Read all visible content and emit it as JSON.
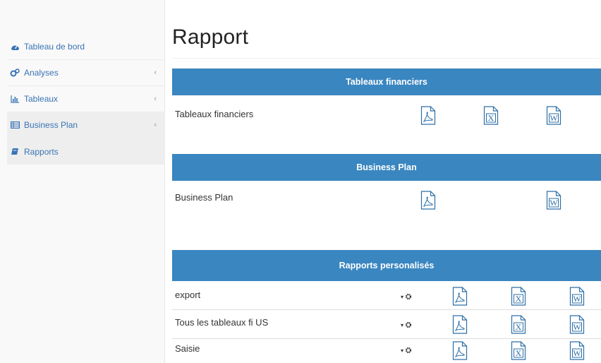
{
  "sidebar": {
    "items": [
      {
        "label": "Tableau de bord",
        "icon": "dashboard-icon"
      },
      {
        "label": "Analyses",
        "icon": "cogs-icon",
        "chevron": "‹"
      },
      {
        "label": "Tableaux",
        "icon": "bar-chart-icon",
        "chevron": "‹"
      },
      {
        "label": "Business Plan",
        "icon": "table-icon",
        "chevron": "‹"
      },
      {
        "label": "Rapports",
        "icon": "book-icon"
      }
    ]
  },
  "page": {
    "title": "Rapport"
  },
  "sections": [
    {
      "header": "Tableaux financiers",
      "rows": [
        {
          "label": "Tableaux financiers",
          "files": [
            "pdf",
            "excel",
            "word"
          ]
        }
      ]
    },
    {
      "header": "Business Plan",
      "rows": [
        {
          "label": "Business Plan",
          "files": [
            "pdf",
            "word"
          ]
        }
      ]
    },
    {
      "header": "Rapports personalisés",
      "rows": [
        {
          "label": "export",
          "files": [
            "settings",
            "pdf",
            "excel",
            "word"
          ]
        },
        {
          "label": "Tous les tableaux fi US",
          "files": [
            "settings",
            "pdf",
            "excel",
            "word"
          ]
        },
        {
          "label": "Saisie",
          "files": [
            "settings",
            "pdf",
            "excel",
            "word"
          ]
        }
      ]
    }
  ],
  "icons": {
    "pdf_letter": "",
    "excel_letter": "X",
    "word_letter": "W",
    "gear_caret": "▾"
  },
  "colors": {
    "band": "#3a86c0",
    "sidebar_link": "#3a74b5",
    "icon_stroke": "#2d6fa6"
  }
}
